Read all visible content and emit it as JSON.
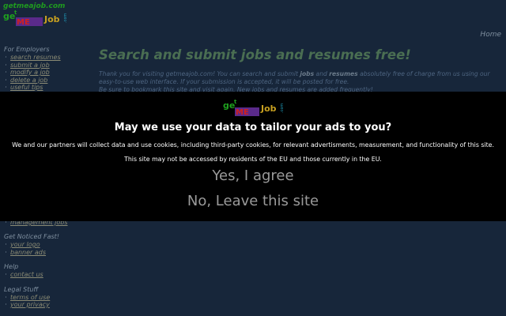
{
  "header": {
    "site_name": "getmeajob.com",
    "home_link": "Home"
  },
  "sidebar": {
    "employers_title": "For Employers",
    "employers_items": [
      "search resumes",
      "submit a job",
      "modify a job",
      "delete a job",
      "useful tips"
    ],
    "partial_item": "management jobs",
    "noticed_title": "Get Noticed Fast!",
    "noticed_items": [
      "your logo",
      "banner ads"
    ],
    "help_title": "Help",
    "help_items": [
      "contact us"
    ],
    "legal_title": "Legal Stuff",
    "legal_items": [
      "terms of use",
      "your privacy"
    ]
  },
  "main": {
    "headline": "Search and submit jobs and resumes free!",
    "intro_part1": "Thank you for visiting getmeajob.com! You can search and submit ",
    "intro_bold1": "jobs",
    "intro_part2": " and ",
    "intro_bold2": "resumes",
    "intro_part3": " absolutely free of charge from us using our easy-to-use web interface. If your submission is accepted, it will be posted for free.",
    "intro_line3": "Be sure to bookmark this site and visit again. New jobs and resumes are added frequently!"
  },
  "consent": {
    "title": "May we use your data to tailor your ads to you?",
    "description": "We and our partners will collect data and use cookies, including third-party cookies, for relevant advertisments, measurement, and functionality of this site.",
    "note": "This site may not be accessed by residents of the EU and those currently in the EU.",
    "agree_label": "Yes, I agree",
    "leave_label": "No, Leave this site"
  },
  "colors": {
    "page_bg": "#17263a",
    "headline": "#4a6e52",
    "overlay_bg": "#000000",
    "logo_green": "#1f9a1f"
  }
}
